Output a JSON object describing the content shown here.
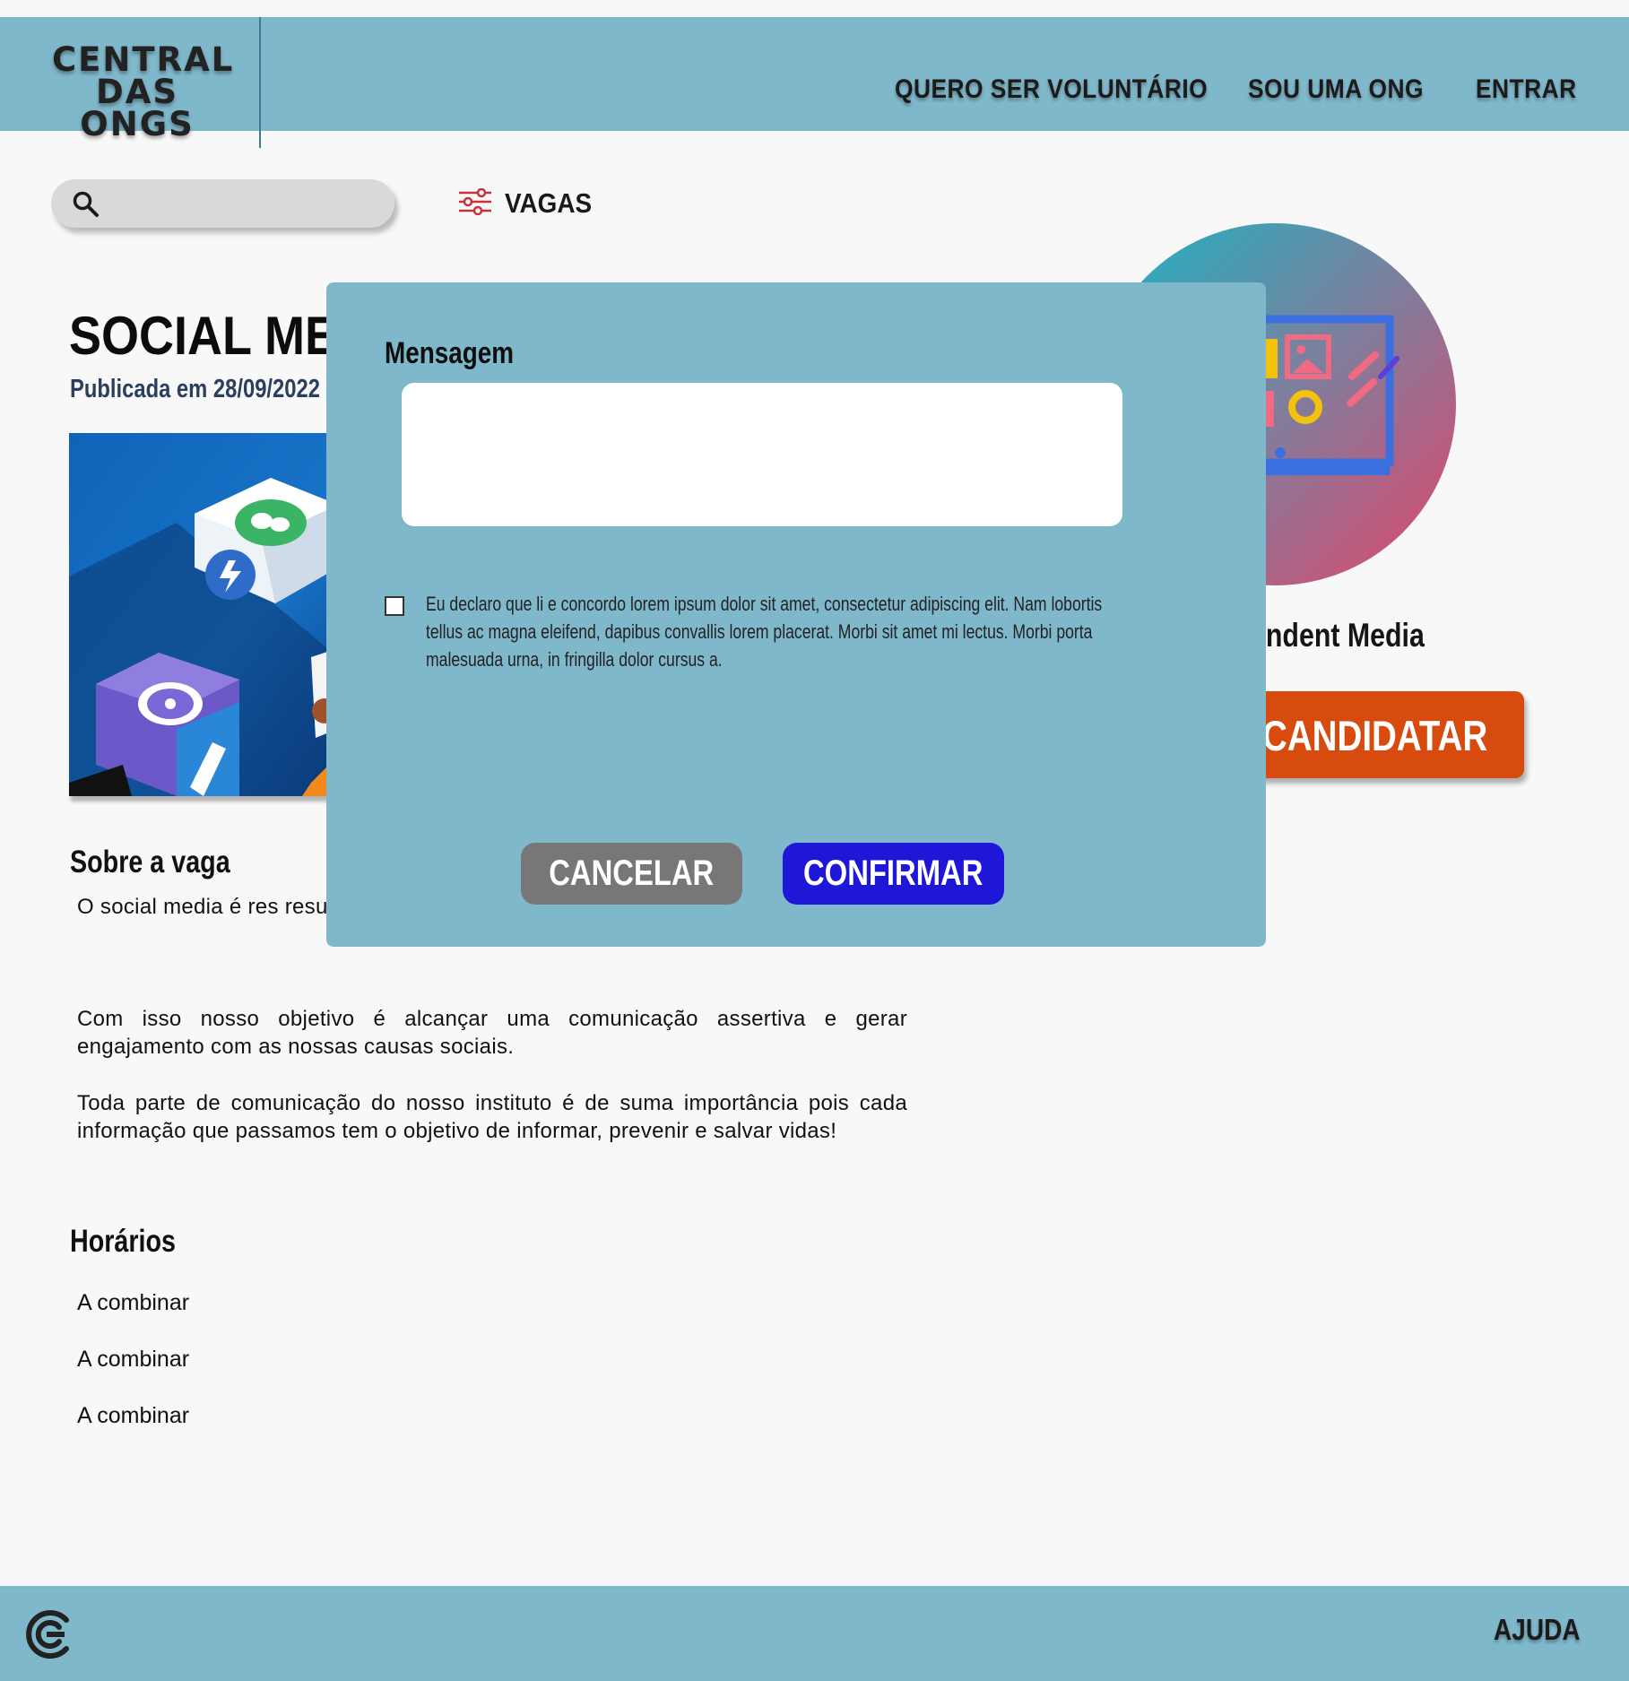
{
  "header": {
    "logo_lines": [
      "CENTRAL",
      "DAS",
      "ONGS"
    ],
    "nav": {
      "volunteer": "QUERO SER VOLUNTÁRIO",
      "ngo": "SOU UMA ONG",
      "login": "ENTRAR"
    }
  },
  "search": {
    "placeholder": "",
    "icon": "search-icon"
  },
  "filter": {
    "label": "VAGAS",
    "icon": "sliders-icon"
  },
  "job": {
    "title": "SOCIAL ME",
    "published": "Publicada em 28/09/2022",
    "about_heading": "Sobre a vaga",
    "paragraphs": [
      "O social media é res resultados, atualizar, m nosso instituto nas redes sociais.",
      "Com isso nosso objetivo é alcançar uma comunicação assertiva e gerar engajamento com as nossas causas sociais.",
      "Toda parte de comunicação do nosso instituto é de suma importância pois cada informação que passamos tem o objetivo de informar, prevenir e salvar vidas!"
    ],
    "schedule_heading": "Horários",
    "schedule": [
      "A combinar",
      "A combinar",
      "A combinar"
    ]
  },
  "organization": {
    "name": "endent Media",
    "apply_label": "CANDIDATAR"
  },
  "modal": {
    "message_label": "Mensagem",
    "message_value": "",
    "checkbox_checked": false,
    "declaration": "Eu declaro que li e concordo lorem ipsum dolor sit amet, consectetur adipiscing elit. Nam lobortis tellus ac magna eleifend, dapibus convallis lorem placerat. Morbi sit amet mi lectus. Morbi porta malesuada urna, in fringilla dolor cursus a.",
    "cancel_label": "CANCELAR",
    "confirm_label": "CONFIRMAR"
  },
  "footer": {
    "logo_icon": "central-das-ongs-c-icon",
    "help_label": "AJUDA"
  },
  "colors": {
    "header_bg": "#80b8cb",
    "apply_button": "#d74b0e",
    "confirm_button": "#1e17d8",
    "cancel_button": "#777777"
  }
}
